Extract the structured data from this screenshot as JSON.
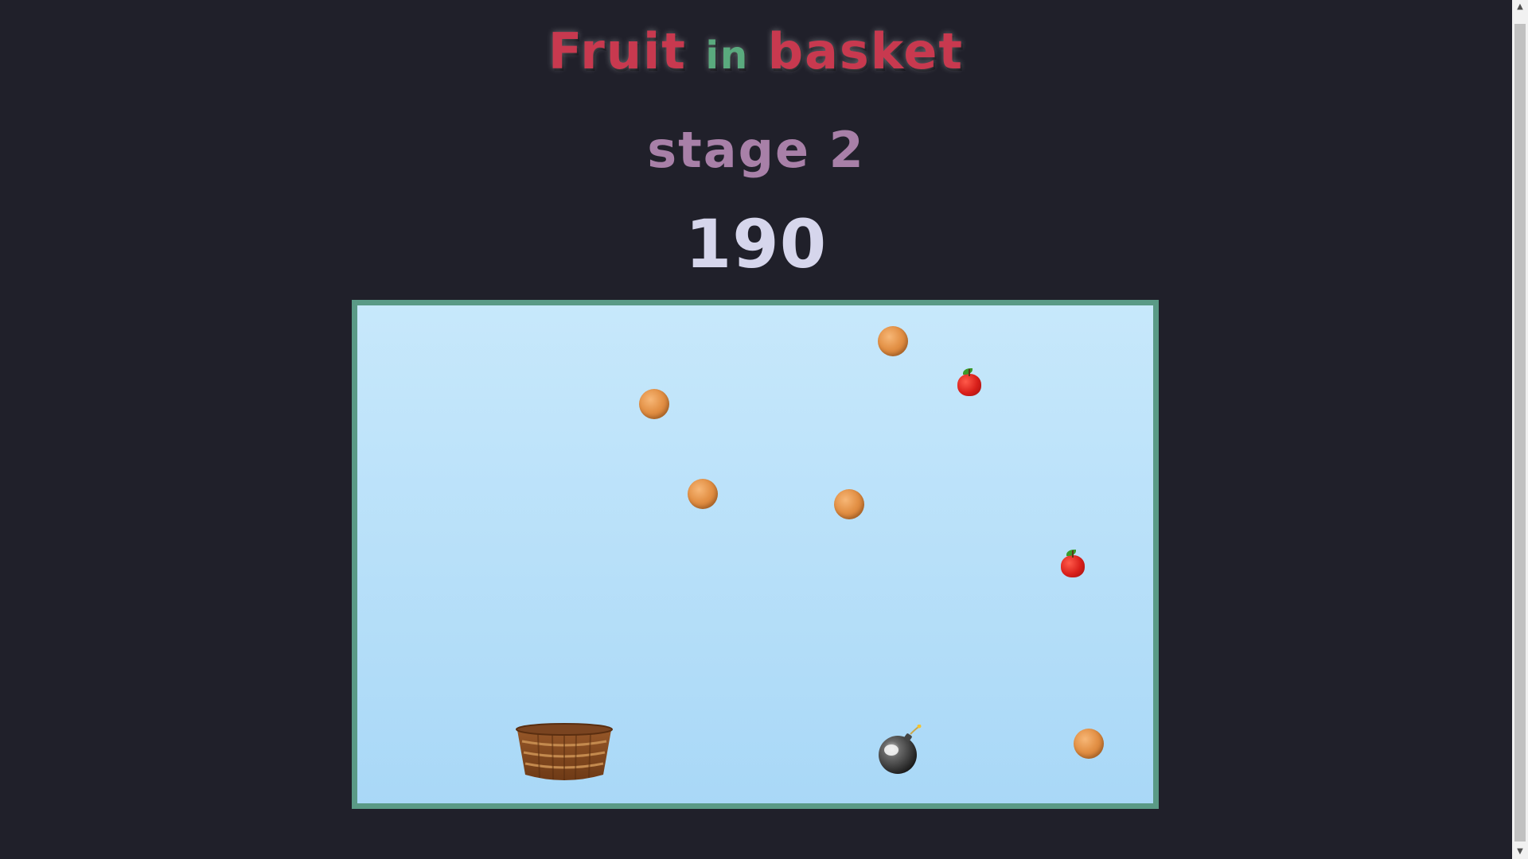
{
  "title": {
    "part1": "Fruit ",
    "part2": "in",
    "part3": " basket"
  },
  "stage_label": "stage 2",
  "score": "190",
  "colors": {
    "title_red": "#c8394f",
    "title_green": "#5aaa7e",
    "stage": "#a880a8",
    "score": "#d6d6ec",
    "board_border": "#5a9a86",
    "background": "#20202a"
  },
  "items": [
    {
      "type": "orange"
    },
    {
      "type": "apple"
    },
    {
      "type": "orange"
    },
    {
      "type": "orange"
    },
    {
      "type": "orange"
    },
    {
      "type": "apple"
    },
    {
      "type": "bomb"
    },
    {
      "type": "orange"
    },
    {
      "type": "basket"
    }
  ]
}
